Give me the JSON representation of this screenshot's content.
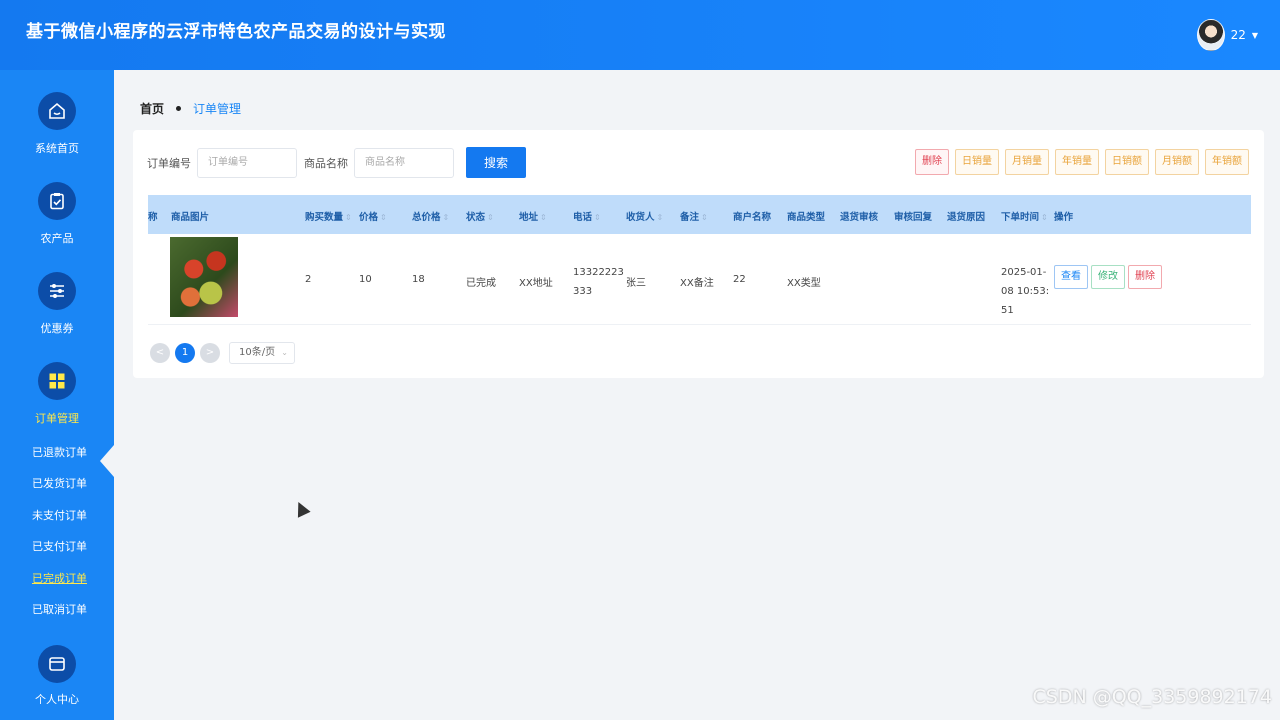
{
  "app": {
    "title": "基于微信小程序的云浮市特色农产品交易的设计与实现"
  },
  "user": {
    "name": "22"
  },
  "sidebar": {
    "items": [
      {
        "label": "系统首页",
        "icon": "home-icon"
      },
      {
        "label": "农产品",
        "icon": "clipboard-check-icon"
      },
      {
        "label": "优惠券",
        "icon": "sliders-icon"
      },
      {
        "label": "订单管理",
        "icon": "grid-icon",
        "active": true
      },
      {
        "label": "个人中心",
        "icon": "wallet-icon"
      }
    ],
    "sub_items": [
      {
        "label": "已退款订单"
      },
      {
        "label": "已发货订单"
      },
      {
        "label": "未支付订单"
      },
      {
        "label": "已支付订单"
      },
      {
        "label": "已完成订单",
        "current": true
      },
      {
        "label": "已取消订单"
      }
    ]
  },
  "breadcrumb": {
    "home": "首页",
    "current": "订单管理"
  },
  "search": {
    "order_no_label": "订单编号",
    "order_no_placeholder": "订单编号",
    "product_name_label": "商品名称",
    "product_name_placeholder": "商品名称",
    "search_button": "搜索"
  },
  "actions": {
    "delete": "删除",
    "daily_qty": "日销量",
    "monthly_qty": "月销量",
    "yearly_qty": "年销量",
    "daily_amt": "日销额",
    "monthly_amt": "月销额",
    "yearly_amt": "年销额"
  },
  "table": {
    "columns": [
      "称",
      "商品图片",
      "购买数量",
      "价格",
      "总价格",
      "状态",
      "地址",
      "电话",
      "收货人",
      "备注",
      "商户名称",
      "商品类型",
      "退货审核",
      "审核回复",
      "退货原因",
      "下单时间",
      "操作"
    ],
    "rows": [
      {
        "qty": "2",
        "price": "10",
        "total": "18",
        "status": "已完成",
        "address": "XX地址",
        "phone": "13322223333",
        "receiver": "张三",
        "remark": "XX备注",
        "merchant": "22",
        "type": "XX类型",
        "return_review": "",
        "review_reply": "",
        "return_reason": "",
        "order_time": "2025-01-08 10:53:51",
        "view": "查看",
        "edit": "修改",
        "delete": "删除"
      }
    ]
  },
  "pagination": {
    "prev": "<",
    "current_page": "1",
    "next": ">",
    "page_size": "10条/页"
  },
  "watermark": "CSDN @QQ_3359892174",
  "colors": {
    "primary": "#1479f0",
    "sidebar": "#1a86f5",
    "active_text": "#ffe84a",
    "header_row": "#bfdcfa"
  }
}
